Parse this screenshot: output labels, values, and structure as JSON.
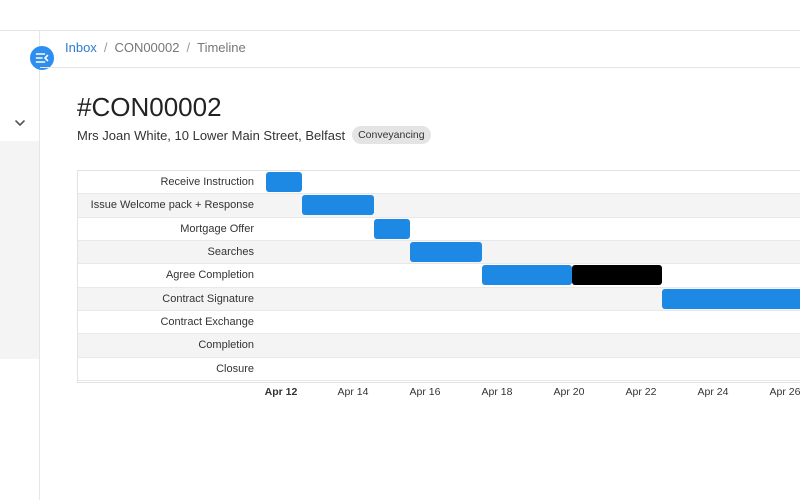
{
  "breadcrumb": {
    "inbox": "Inbox",
    "case": "CON00002",
    "page": "Timeline",
    "separator": "/"
  },
  "case": {
    "title": "#CON00002",
    "client_address": "Mrs Joan White, 10 Lower Main Street, Belfast",
    "type_badge": "Conveyancing"
  },
  "icons": {
    "collapse": "menu-collapse-icon",
    "expand": "chevron-down-icon"
  },
  "colors": {
    "accent": "#2d8ef0",
    "bar_blue": "#1e88e5",
    "bar_black": "#000000",
    "link": "#2d7bd0"
  },
  "gantt": {
    "tasks": [
      {
        "label": "Receive Instruction",
        "segments": [
          {
            "start": "Apr 12",
            "end": "Apr 13",
            "color": "blue"
          }
        ]
      },
      {
        "label": "Issue Welcome pack + Response",
        "segments": [
          {
            "start": "Apr 13",
            "end": "Apr 15",
            "color": "blue"
          }
        ]
      },
      {
        "label": "Mortgage Offer",
        "segments": [
          {
            "start": "Apr 15",
            "end": "Apr 16",
            "color": "blue"
          }
        ]
      },
      {
        "label": "Searches",
        "segments": [
          {
            "start": "Apr 16",
            "end": "Apr 18",
            "color": "blue"
          }
        ]
      },
      {
        "label": "Agree Completion",
        "segments": [
          {
            "start": "Apr 18",
            "end": "Apr 20.5",
            "color": "blue"
          },
          {
            "start": "Apr 20.5",
            "end": "Apr 23",
            "color": "black"
          }
        ]
      },
      {
        "label": "Contract Signature",
        "segments": [
          {
            "start": "Apr 23",
            "end": "Apr 27+",
            "color": "blue"
          }
        ]
      },
      {
        "label": "Contract Exchange",
        "segments": []
      },
      {
        "label": "Completion",
        "segments": []
      },
      {
        "label": "Closure",
        "segments": []
      }
    ],
    "axis_ticks": [
      "Apr 12",
      "Apr 14",
      "Apr 16",
      "Apr 18",
      "Apr 20",
      "Apr 22",
      "Apr 24",
      "Apr 26"
    ],
    "current_tick": "Apr 12"
  }
}
